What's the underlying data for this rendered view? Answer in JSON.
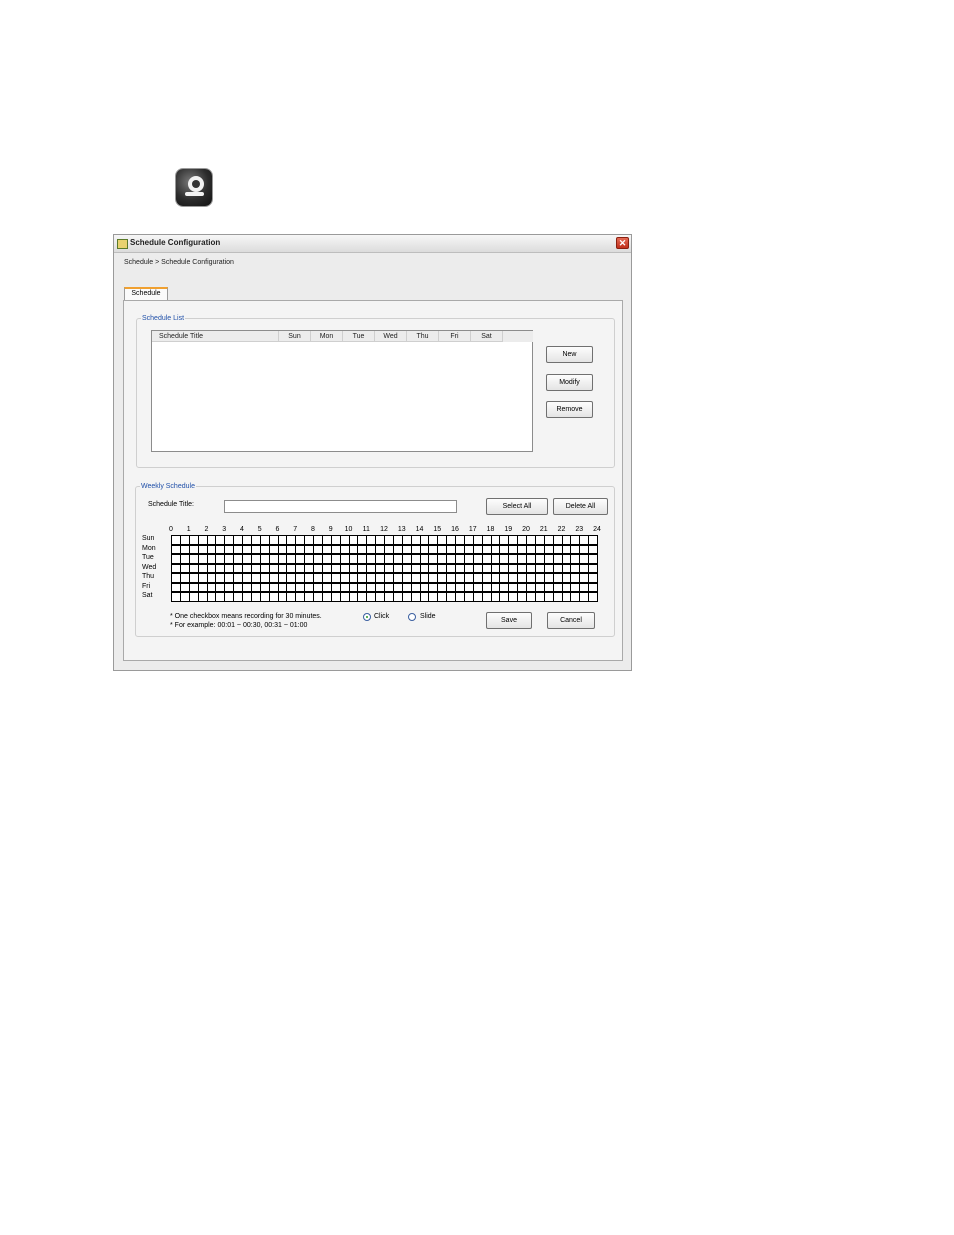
{
  "window": {
    "title": "Schedule Configuration",
    "close_symbol": "✕",
    "breadcrumb": "Schedule > Schedule Configuration",
    "tab": "Schedule"
  },
  "schedule_list": {
    "legend": "Schedule List",
    "columns": [
      "Schedule Title",
      "Sun",
      "Mon",
      "Tue",
      "Wed",
      "Thu",
      "Fri",
      "Sat"
    ],
    "rows": [],
    "buttons": {
      "new": "New",
      "modify": "Modify",
      "remove": "Remove"
    }
  },
  "weekly": {
    "legend": "Weekly Schedule",
    "title_label": "Schedule Title:",
    "title_value": "",
    "select_all": "Select All",
    "delete_all": "Delete All",
    "hours": [
      "0",
      "1",
      "2",
      "3",
      "4",
      "5",
      "6",
      "7",
      "8",
      "9",
      "10",
      "11",
      "12",
      "13",
      "14",
      "15",
      "16",
      "17",
      "18",
      "19",
      "20",
      "21",
      "22",
      "23",
      "24"
    ],
    "days": [
      "Sun",
      "Mon",
      "Tue",
      "Wed",
      "Thu",
      "Fri",
      "Sat"
    ],
    "slots_per_day": 48,
    "note1": "* One checkbox means recording for 30 minutes.",
    "note2": "* For example: 00:01 ~ 00:30, 00:31 ~ 01:00",
    "mode_click": "Click",
    "mode_slide": "Slide",
    "selected_mode": "Click",
    "save": "Save",
    "cancel": "Cancel"
  },
  "icons": {
    "app": "camera-schedule-icon",
    "window": "window-icon",
    "close": "close-icon"
  }
}
